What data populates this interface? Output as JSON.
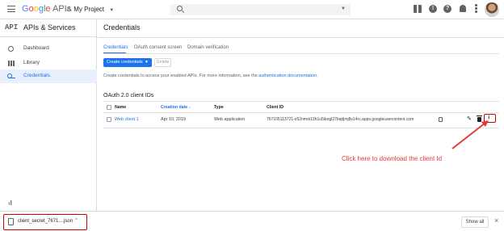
{
  "topbar": {
    "brand_google": [
      "G",
      "o",
      "o",
      "g",
      "l",
      "e"
    ],
    "brand_apis": "APIs",
    "project_name": "My Project"
  },
  "sidebar": {
    "api_mark": "API",
    "title": "APIs & Services",
    "items": [
      {
        "label": "Dashboard",
        "icon": "dashboard-icon"
      },
      {
        "label": "Library",
        "icon": "library-icon"
      },
      {
        "label": "Credentials",
        "icon": "key-icon",
        "active": true
      }
    ],
    "collapse_glyph": "‹I"
  },
  "main": {
    "title": "Credentials",
    "tabs": [
      {
        "label": "Credentials",
        "active": true
      },
      {
        "label": "OAuth consent screen"
      },
      {
        "label": "Domain verification"
      }
    ],
    "create_button": "Create credentials",
    "delete_button": "Delete",
    "info_text": "Create credentials to access your enabled APIs. For more information, see the ",
    "info_link": "authentication documentation",
    "info_end": ".",
    "section_title": "OAuth 2.0 client IDs",
    "table": {
      "headers": [
        "Name",
        "Creation date",
        "Type",
        "Client ID"
      ],
      "rows": [
        {
          "name": "Web client 1",
          "date": "Apr 10, 2019",
          "type": "Web application",
          "client_id": "767105113721-o52nmrk13h1u5ibogl27bqdjmj8v14rc.apps.googleusercontent.com"
        }
      ]
    }
  },
  "annotation": {
    "text": "Click here to download the  client Id",
    "color": "#e53935"
  },
  "download_bar": {
    "file_name": "client_secret_7671....json",
    "show_all": "Show all"
  },
  "colors": {
    "accent": "#1a73e8",
    "highlight_border": "#d50000"
  }
}
